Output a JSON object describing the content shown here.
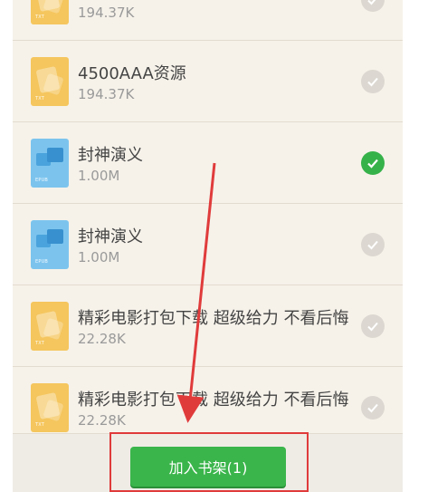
{
  "files": [
    {
      "name": "",
      "size": "194.37K",
      "type": "txt",
      "icon": "txt-file-icon",
      "selected": false
    },
    {
      "name": "4500AAA资源",
      "size": "194.37K",
      "type": "txt",
      "icon": "txt-file-icon",
      "selected": false
    },
    {
      "name": "封神演义",
      "size": "1.00M",
      "type": "epub",
      "icon": "epub-file-icon",
      "selected": true
    },
    {
      "name": "封神演义",
      "size": "1.00M",
      "type": "epub",
      "icon": "epub-file-icon",
      "selected": false
    },
    {
      "name": "精彩电影打包下载 超级给力 不看后悔",
      "size": "22.28K",
      "type": "txt",
      "icon": "txt-file-icon",
      "selected": false
    },
    {
      "name": "精彩电影打包下载 超级给力 不看后悔",
      "size": "22.28K",
      "type": "txt",
      "icon": "txt-file-icon",
      "selected": false
    }
  ],
  "footer": {
    "add_to_shelf_label": "加入书架(1)"
  },
  "colors": {
    "selected": "#36b24a",
    "unselected": "#dcd8d1",
    "annotation": "#e03b3b",
    "button": "#3ab54b"
  }
}
